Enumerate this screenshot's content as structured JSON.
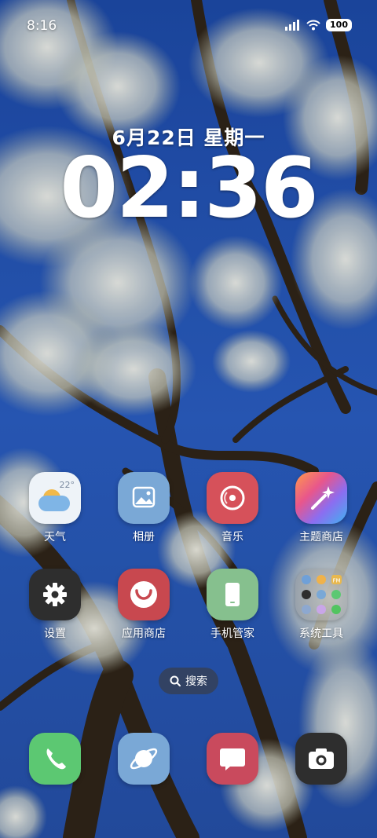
{
  "status_bar": {
    "time": "8:16",
    "battery": "100"
  },
  "lockscreen": {
    "date": "6月22日 星期一",
    "clock": "02:36"
  },
  "apps": [
    {
      "label": "天气",
      "icon": "weather-icon",
      "temp": "22°"
    },
    {
      "label": "相册",
      "icon": "gallery-icon"
    },
    {
      "label": "音乐",
      "icon": "music-icon"
    },
    {
      "label": "主题商店",
      "icon": "magic-wand-icon"
    },
    {
      "label": "设置",
      "icon": "gear-icon"
    },
    {
      "label": "应用商店",
      "icon": "smile-bag-icon"
    },
    {
      "label": "手机管家",
      "icon": "phone-shield-icon"
    },
    {
      "label": "系统工具",
      "icon": "folder-icon",
      "folder_tag": "FM"
    }
  ],
  "search": {
    "label": "搜索"
  },
  "dock": [
    {
      "icon": "phone-icon"
    },
    {
      "icon": "browser-icon"
    },
    {
      "icon": "message-icon"
    },
    {
      "icon": "camera-icon"
    }
  ],
  "colors": {
    "sky": "#2a56b8",
    "branch": "#3b2e22",
    "blossom": "#eef0e4",
    "gallery": "#7aa8d6",
    "music": "#d6515a",
    "appstore": "#c8484f",
    "manager": "#86c08e",
    "phone": "#5cc872",
    "browser": "#7aa8d6",
    "message": "#c94a5d",
    "camera": "#2e2e2e",
    "settings": "#2e2e2e"
  }
}
